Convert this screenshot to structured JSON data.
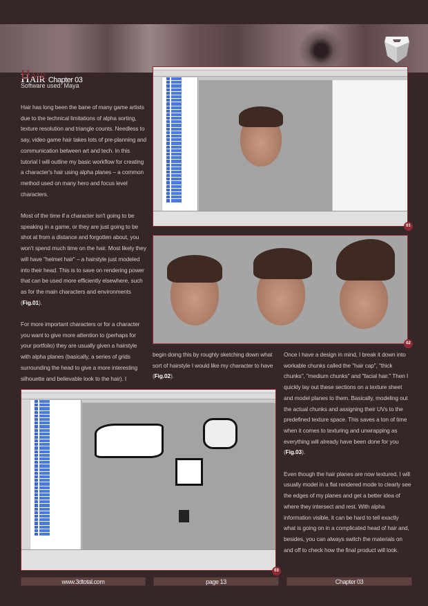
{
  "header": {
    "title": "Hair",
    "chapter": "Chapter 03"
  },
  "article": {
    "title": "Hair",
    "software": "Software used: Maya",
    "col1": [
      "Hair has long been the bane of many game artists due to the technical limitations of alpha sorting, texture resolution and triangle counts. Needless to say, video game hair takes lots of pre-planning and communication between art and tech. In this tutorial I will outline my basic workflow for creating a character's hair using alpha planes – a common method used on many hero and focus level characters.",
      "Most of the time if a character isn't going to be speaking in a game, or they are just going to be shot at from a distance and forgotten about, you won't spend much time on the hair. Most likely they will have \"helmet hair\" – a hairstyle just modeled into their head. This is to save on rendering power that can be used more efficiently elsewhere, such as for the main characters and environments (",
      "For more important characters or for a character you want to give more attention to (perhaps for your portfolio) they are usually given a hairstyle with alpha planes (basically, a series of grids surrounding the head to give a more interesting silhouette and believable look to the hair). I"
    ],
    "col1_fig": "Fig.01",
    "col2": "begin doing this by roughly sketching down what sort of hairstyle I would like my character to have (",
    "col2_fig": "Fig.02",
    "col3": [
      "Once I have a design in mind, I break it down into workable chunks called the \"hair cap\", \"thick chunks\", \"medium chunks\" and \"facial hair.\"  Then I quickly lay out these sections on a texture sheet and model planes to them. Basically, modeling out the actual chunks and assigning their UVs to the predefined texture space. This saves a ton of time when it comes to texturing and unwrapping as everything will already have been done for you (",
      "Even though the hair planes are now textured, I will usually model in a flat rendered mode to clearly see the edges of my planes and get a better idea of where they intersect and rest. With alpha information visible, it can be hard to tell exactly what is going on in a complicated head of hair and, besides, you can always switch the materials on and off to check how the final product will look."
    ],
    "col3_fig": "Fig.03",
    "close": ")."
  },
  "figures": [
    {
      "badge": "01"
    },
    {
      "badge": "02"
    },
    {
      "badge": "03"
    }
  ],
  "footer": {
    "site": "www.3dtotal.com",
    "page": "page 13",
    "chapter": "Chapter 03"
  },
  "colors": {
    "background": "#362628",
    "accent": "#8e2b31",
    "footer_box": "#5e4242"
  }
}
